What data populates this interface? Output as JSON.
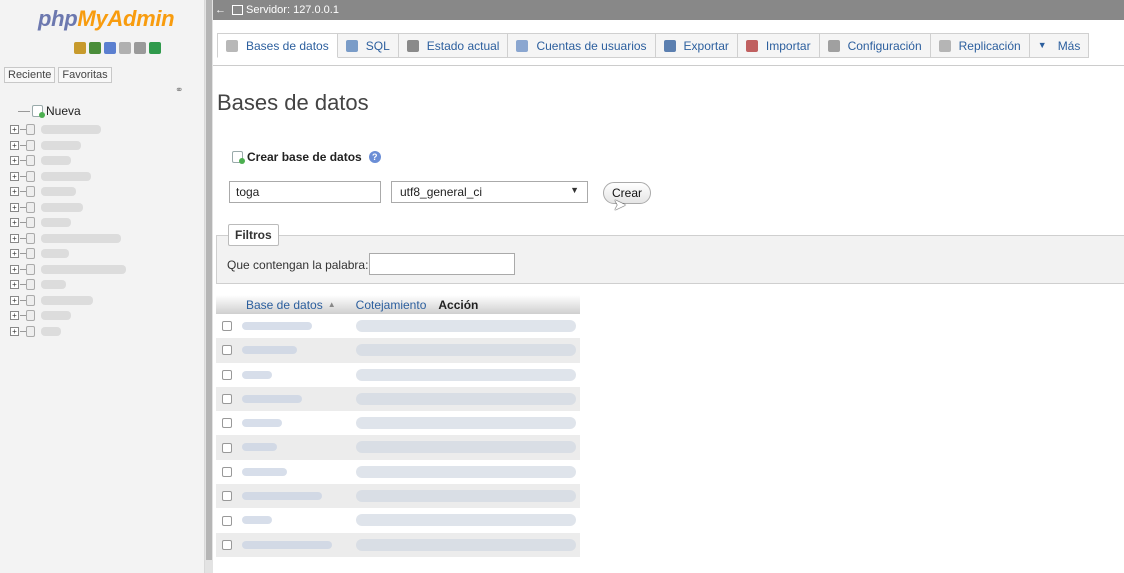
{
  "nav": {
    "logo_php": "php",
    "logo_myadmin": "MyAdmin",
    "icons": [
      {
        "name": "home-icon",
        "color": "#c79a2c"
      },
      {
        "name": "exit-icon",
        "color": "#4a8d3a"
      },
      {
        "name": "help-icon",
        "color": "#5b7fd0"
      },
      {
        "name": "docs-icon",
        "color": "#b0b0b0"
      },
      {
        "name": "settings-icon",
        "color": "#9a9a9a"
      },
      {
        "name": "reload-icon",
        "color": "#2f9a4c"
      }
    ],
    "tabs": [
      "Reciente",
      "Favoritas"
    ],
    "tree_new_label": "Nueva",
    "tree_db_count": 14
  },
  "serverbar": {
    "server_label": "Servidor: 127.0.0.1"
  },
  "menu": {
    "tabs": [
      {
        "label": "Bases de datos",
        "icon": "database-icon",
        "color": "#b8b8b8",
        "active": true
      },
      {
        "label": "SQL",
        "icon": "sql-icon",
        "color": "#7a9cc8",
        "active": false
      },
      {
        "label": "Estado actual",
        "icon": "status-icon",
        "color": "#8a8a8a",
        "active": false
      },
      {
        "label": "Cuentas de usuarios",
        "icon": "users-icon",
        "color": "#8aa6d0",
        "active": false
      },
      {
        "label": "Exportar",
        "icon": "export-icon",
        "color": "#5b7fb0",
        "active": false
      },
      {
        "label": "Importar",
        "icon": "import-icon",
        "color": "#c06060",
        "active": false
      },
      {
        "label": "Configuración",
        "icon": "wrench-icon",
        "color": "#a0a0a0",
        "active": false
      },
      {
        "label": "Replicación",
        "icon": "replication-icon",
        "color": "#b5b5b5",
        "active": false
      },
      {
        "label": "Más",
        "icon": "chevron-down-icon",
        "color": "#2c5f9e",
        "active": false
      }
    ]
  },
  "main": {
    "page_title": "Bases de datos",
    "create_db_label": "Crear base de datos",
    "dbname_value": "toga",
    "collation_value": "utf8_general_ci",
    "create_button_label": "Crear",
    "filters_legend": "Filtros",
    "filter_label": "Que contengan la palabra:",
    "filter_value": "",
    "table": {
      "col_db": "Base de datos",
      "col_collation": "Cotejamiento",
      "col_action": "Acción",
      "row_count": 10
    }
  }
}
